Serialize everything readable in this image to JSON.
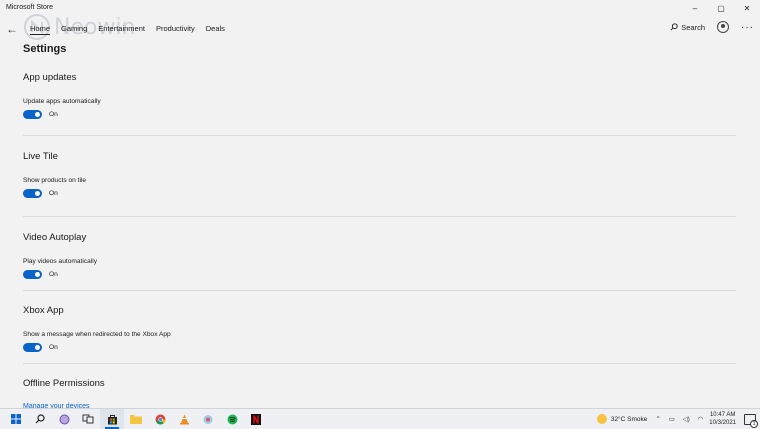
{
  "window": {
    "title": "Microsoft Store",
    "controls": {
      "minimize": "–",
      "maximize": "▢",
      "close": "✕"
    }
  },
  "watermark": {
    "text": "Neowin"
  },
  "nav": {
    "tabs": [
      "Home",
      "Gaming",
      "Entertainment",
      "Productivity",
      "Deals"
    ],
    "active_tab": "Home",
    "search_label": "Search",
    "more": "···"
  },
  "page": {
    "title": "Settings"
  },
  "sections": [
    {
      "heading": "App updates",
      "desc": "Update apps automatically",
      "state": "On"
    },
    {
      "heading": "Live Tile",
      "desc": "Show products on tile",
      "state": "On"
    },
    {
      "heading": "Video Autoplay",
      "desc": "Play videos automatically",
      "state": "On"
    },
    {
      "heading": "Xbox App",
      "desc": "Show a message when redirected to the Xbox App",
      "state": "On"
    },
    {
      "heading": "Offline Permissions"
    }
  ],
  "links": {
    "manage_devices": "Manage your devices"
  },
  "taskbar": {
    "weather": {
      "temp": "32°C",
      "condition": "Smoke"
    },
    "clock": {
      "time": "10:47 AM",
      "date": "10/3/2021"
    },
    "notifications": "1",
    "apps": [
      "windows-start",
      "search",
      "cortana",
      "task-view",
      "microsoft-store",
      "file-explorer",
      "chrome",
      "vlc",
      "photo-app",
      "spotify",
      "netflix"
    ]
  },
  "colors": {
    "accent": "#0a63c9",
    "background": "#f2f2f2"
  }
}
